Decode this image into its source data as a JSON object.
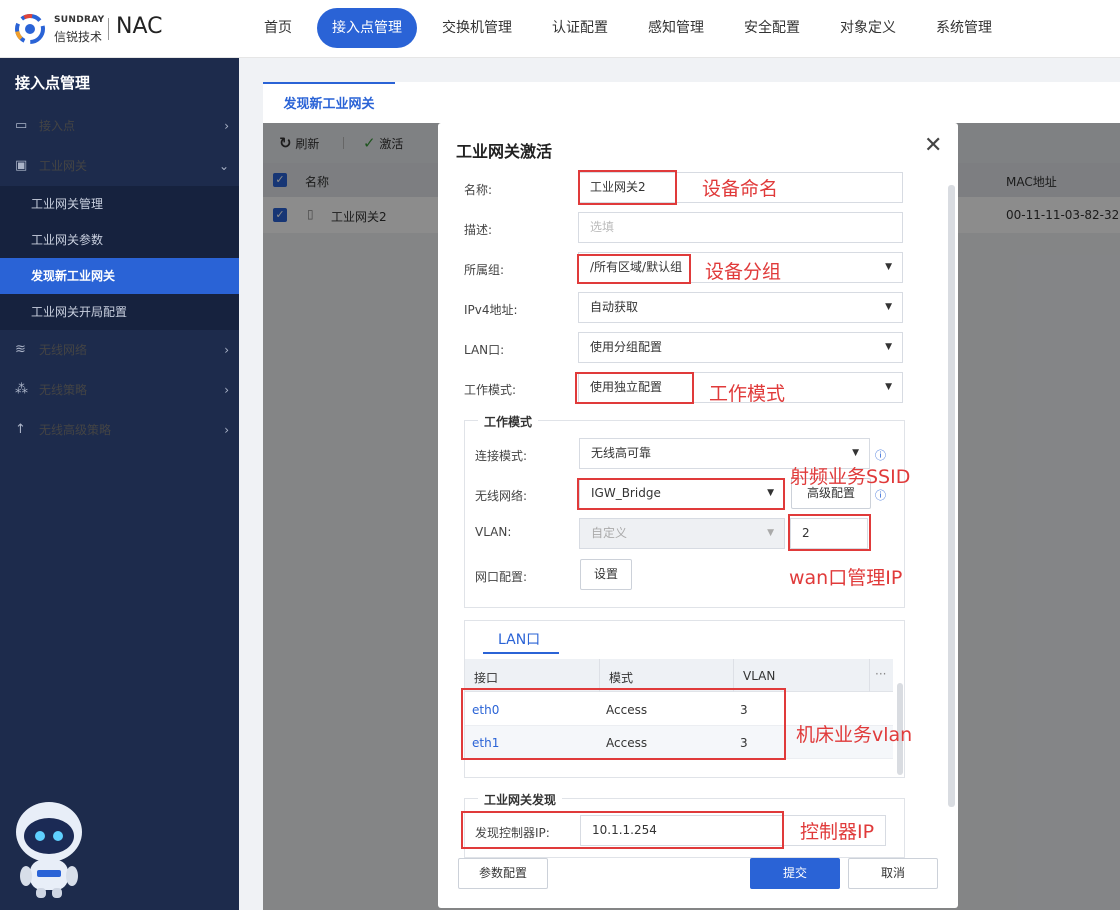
{
  "header": {
    "logo_en": "SUNDRAY",
    "logo_cn": "信锐技术",
    "product": "NAC",
    "nav": [
      "首页",
      "接入点管理",
      "交换机管理",
      "认证配置",
      "感知管理",
      "安全配置",
      "对象定义",
      "系统管理"
    ],
    "active_nav": "接入点管理"
  },
  "sidebar": {
    "title": "接入点管理",
    "items": [
      {
        "label": "接入点",
        "icon": "router-icon"
      },
      {
        "label": "工业网关",
        "icon": "gateway-icon",
        "expanded": true
      },
      {
        "label": "无线网络",
        "icon": "wifi-icon"
      },
      {
        "label": "无线策略",
        "icon": "nodes-icon"
      },
      {
        "label": "无线高级策略",
        "icon": "advanced-icon"
      }
    ],
    "sub_items": [
      "工业网关管理",
      "工业网关参数",
      "发现新工业网关",
      "工业网关开局配置"
    ],
    "active_sub": "发现新工业网关"
  },
  "main": {
    "tab": "发现新工业网关",
    "toolbar": {
      "refresh": "刷新",
      "activate": "激活"
    },
    "grid": {
      "columns": [
        "名称",
        "MAC地址"
      ],
      "row": {
        "name": "工业网关2",
        "mac": "00-11-11-03-82-32"
      }
    }
  },
  "modal": {
    "title": "工业网关激活",
    "fields": {
      "name_label": "名称:",
      "name_value": "工业网关2",
      "desc_label": "描述:",
      "desc_placeholder": "选填",
      "group_label": "所属组:",
      "group_value": "/所有区域/默认组",
      "ipv4_label": "IPv4地址:",
      "ipv4_value": "自动获取",
      "lan_label": "LAN口:",
      "lan_value": "使用分组配置",
      "mode_label": "工作模式:",
      "mode_value": "使用独立配置"
    },
    "work_mode": {
      "title": "工作模式",
      "conn_label": "连接模式:",
      "conn_value": "无线高可靠",
      "wifi_label": "无线网络:",
      "wifi_value": "IGW_Bridge",
      "adv_button": "高级配置",
      "vlan_label": "VLAN:",
      "vlan_select": "自定义",
      "vlan_value": "2",
      "wan_label": "网口配置:",
      "wan_button": "设置"
    },
    "lan_table": {
      "tab": "LAN口",
      "columns": [
        "接口",
        "模式",
        "VLAN"
      ],
      "rows": [
        {
          "iface": "eth0",
          "mode": "Access",
          "vlan": "3"
        },
        {
          "iface": "eth1",
          "mode": "Access",
          "vlan": "3"
        }
      ]
    },
    "discovery": {
      "title": "工业网关发现",
      "label": "发现控制器IP:",
      "value": "10.1.1.254"
    },
    "buttons": {
      "params": "参数配置",
      "submit": "提交",
      "cancel": "取消"
    }
  },
  "annotations": {
    "name": "设备命名",
    "group": "设备分组",
    "mode": "工作模式",
    "ssid": "射频业务SSID",
    "wan": "wan口管理IP",
    "vlan": "机床业务vlan",
    "controller": "控制器IP"
  },
  "colors": {
    "accent": "#2a63d6",
    "sidebar": "#1d2b4c",
    "annotation": "#e03a3a"
  }
}
